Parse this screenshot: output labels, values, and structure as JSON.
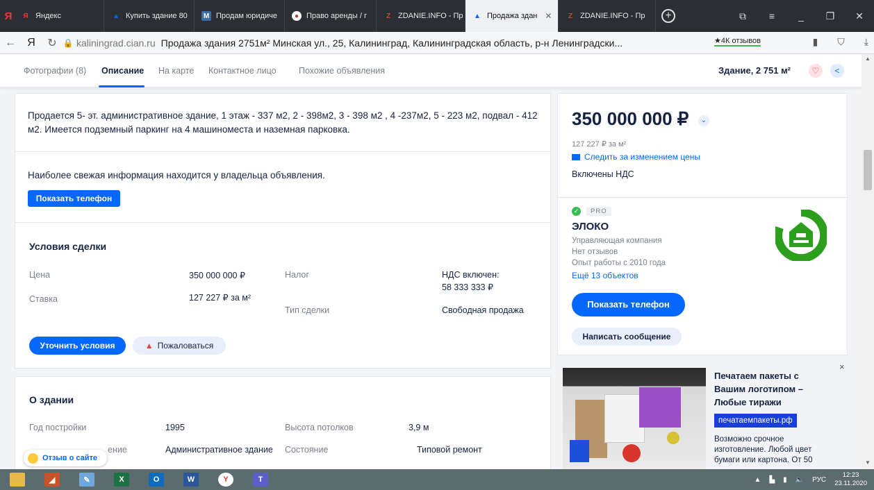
{
  "browser": {
    "brand_glyph": "Я",
    "tabs": [
      {
        "label": "Яндекс",
        "icon": "yandex-icon",
        "color": "#ff3333"
      },
      {
        "label": "Купить здание 80",
        "icon": "cian-icon",
        "color": "#0468ff"
      },
      {
        "label": "Продам юридиче",
        "icon": "site-icon",
        "color": "#3a6ea5"
      },
      {
        "label": "Право аренды / г",
        "icon": "globe-icon",
        "color": "#c0392b"
      },
      {
        "label": "ZDANIE.INFO - Пр",
        "icon": "zdanie-icon",
        "color": "#e53935"
      },
      {
        "label": "Продажа здан",
        "icon": "cian-icon",
        "color": "#0468ff",
        "active": true
      },
      {
        "label": "ZDANIE.INFO - Пр",
        "icon": "zdanie-icon",
        "color": "#e53935"
      }
    ],
    "address": {
      "domain": "kaliningrad.cian.ru",
      "title": "Продажа здания 2751м² Минская ул., 25, Калининград, Калининградская область, р-н Ленинградски...",
      "reviews": "★4К отзывов"
    }
  },
  "section_nav": {
    "items": [
      "Фотографии (8)",
      "Описание",
      "На карте",
      "Контактное лицо",
      "Похожие объявления"
    ],
    "active_index": 1,
    "summary": "Здание, 2 751 м²"
  },
  "description": {
    "text": "Продается 5- эт. административное здание, 1 этаж - 337 м2,  2 - 398м2,  3 - 398 м2 , 4 -237м2,  5 - 223 м2, подвал - 412 м2. Имеется подземный паркинг на 4 машиноместа и наземная парковка."
  },
  "contact_notice": {
    "text": "Наиболее свежая информация находится у владельца объявления.",
    "button": "Показать телефон"
  },
  "deal_terms": {
    "heading": "Условия сделки",
    "rows": {
      "price_label": "Цена",
      "price_value": "350 000 000 ₽",
      "rate_label": "Ставка",
      "rate_value": "127 227 ₽ за м²",
      "tax_label": "Налог",
      "tax_value_line1": "НДС включен:",
      "tax_value_line2": "58 333 333 ₽",
      "deal_type_label": "Тип сделки",
      "deal_type_value": "Свободная продажа"
    },
    "clarify_button": "Уточнить условия",
    "complain_button": "Пожаловаться"
  },
  "building": {
    "heading": "О здании",
    "year_label": "Год постройки",
    "year_value": "1995",
    "ceiling_label": "Высота потолков",
    "ceiling_value": "3,9 м",
    "purpose_label_partial": "ение",
    "purpose_value": "Административное здание",
    "condition_label": "Состояние",
    "condition_value": "Типовой ремонт"
  },
  "price_card": {
    "price": "350 000 000 ₽",
    "per_sqm": "127 227 ₽ за м²",
    "follow_link": "Следить за изменением цены",
    "vat": "Включены НДС"
  },
  "agent_card": {
    "badge": "PRO",
    "name": "ЭЛОКО",
    "type": "Управляющая компания",
    "reviews": "Нет отзывов",
    "experience": "Опыт работы с 2010 года",
    "more_objects": "Ещё 13 объектов",
    "phone_button": "Показать телефон",
    "message_button": "Написать сообщение",
    "logo_color": "#2ca01c"
  },
  "ad": {
    "title": "Печатаем пакеты с Вашим логотипом – Любые тиражи",
    "url": "печатаемпакеты.рф",
    "text": "Возможно срочное изготовление. Любой цвет бумаги или картона. От 50",
    "close": "×"
  },
  "feedback": {
    "label": "Отзыв о сайте"
  },
  "taskbar": {
    "apps": [
      "file-explorer-icon",
      "matlab-icon",
      "paint-icon",
      "excel-icon",
      "outlook-icon",
      "word-icon",
      "yandex-browser-icon",
      "teams-icon"
    ],
    "lang": "РУС",
    "time": "12:23",
    "date": "23.11.2020"
  },
  "colors": {
    "accent": "#0468ff",
    "text": "#152242",
    "muted": "#7a7f8a"
  }
}
